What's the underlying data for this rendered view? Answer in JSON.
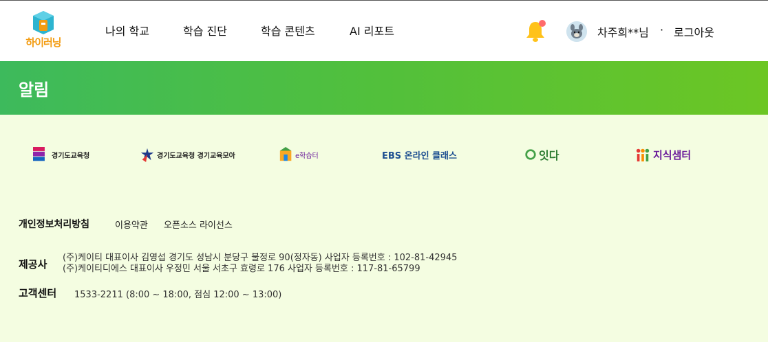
{
  "header": {
    "logo_text": "하이러닝",
    "nav": [
      "나의 학교",
      "학습 진단",
      "학습 콘텐츠",
      "AI 리포트"
    ],
    "user_name": "차주희**님",
    "separator": "·",
    "logout_label": "로그아웃"
  },
  "banner": {
    "title": "알림"
  },
  "partners": [
    {
      "label": "경기도교육청",
      "icon": "gyeonggi-office-logo"
    },
    {
      "label": "경기도교육청 경기교육모아",
      "icon": "gyeonggi-moa-logo"
    },
    {
      "label": "e학습터",
      "icon": "e-learning-logo"
    },
    {
      "label": "EBS 온라인 클래스",
      "icon": "ebs-logo"
    },
    {
      "label": "잇다",
      "icon": "itda-logo"
    },
    {
      "label": "지식샘터",
      "icon": "knowledge-samter-logo"
    }
  ],
  "footer": {
    "privacy_label": "개인정보처리방침",
    "terms_label": "이용약관",
    "opensource_label": "오픈소스 라이선스",
    "provider_label": "제공사",
    "provider_lines": [
      "(주)케이티 대표이사 김영섭 경기도 성남시 분당구 불정로 90(정자동) 사업자 등록번호 : 102-81-42945",
      "(주)케이티디에스 대표이사 우정민 서울 서초구 효령로 176 사업자 등록번호 : 117-81-65799"
    ],
    "cs_label": "고객센터",
    "cs_text": "1533-2211 (8:00 ~ 18:00, 점심 12:00 ~ 13:00)"
  },
  "colors": {
    "brand_orange": "#f39c12",
    "banner_green_start": "#3dba5c",
    "banner_green_end": "#6cc624",
    "page_bg": "#f4fde1",
    "notification_dot": "#ff6b6b"
  }
}
